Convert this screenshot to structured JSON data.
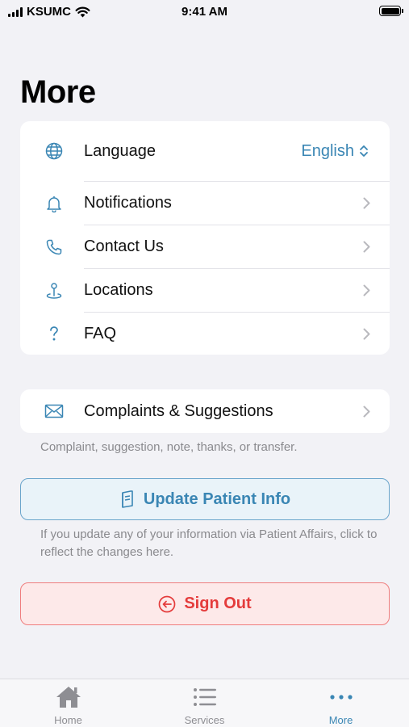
{
  "status_bar": {
    "carrier": "KSUMC",
    "time": "9:41 AM"
  },
  "page": {
    "title": "More"
  },
  "settings": {
    "language": {
      "label": "Language",
      "value": "English",
      "icon": "globe-icon"
    },
    "items": [
      {
        "label": "Notifications",
        "icon": "bell-icon"
      },
      {
        "label": "Contact Us",
        "icon": "phone-icon"
      },
      {
        "label": "Locations",
        "icon": "location-pin-icon"
      },
      {
        "label": "FAQ",
        "icon": "question-mark-icon"
      }
    ]
  },
  "complaints": {
    "label": "Complaints & Suggestions",
    "icon": "envelope-icon",
    "note": "Complaint, suggestion, note, thanks, or transfer."
  },
  "update_info": {
    "label": "Update Patient Info",
    "icon": "document-icon",
    "note": "If you update any of your information via Patient Affairs, click to reflect the changes here."
  },
  "sign_out": {
    "label": "Sign Out",
    "icon": "sign-out-icon"
  },
  "tab_bar": {
    "tabs": [
      {
        "label": "Home",
        "icon": "home-icon",
        "active": false
      },
      {
        "label": "Services",
        "icon": "list-icon",
        "active": false
      },
      {
        "label": "More",
        "icon": "more-dots-icon",
        "active": true
      }
    ]
  },
  "colors": {
    "accent": "#3a86b4",
    "danger": "#e43b3b",
    "background": "#f2f2f6",
    "card": "#ffffff",
    "muted_text": "#8a8a8e"
  }
}
